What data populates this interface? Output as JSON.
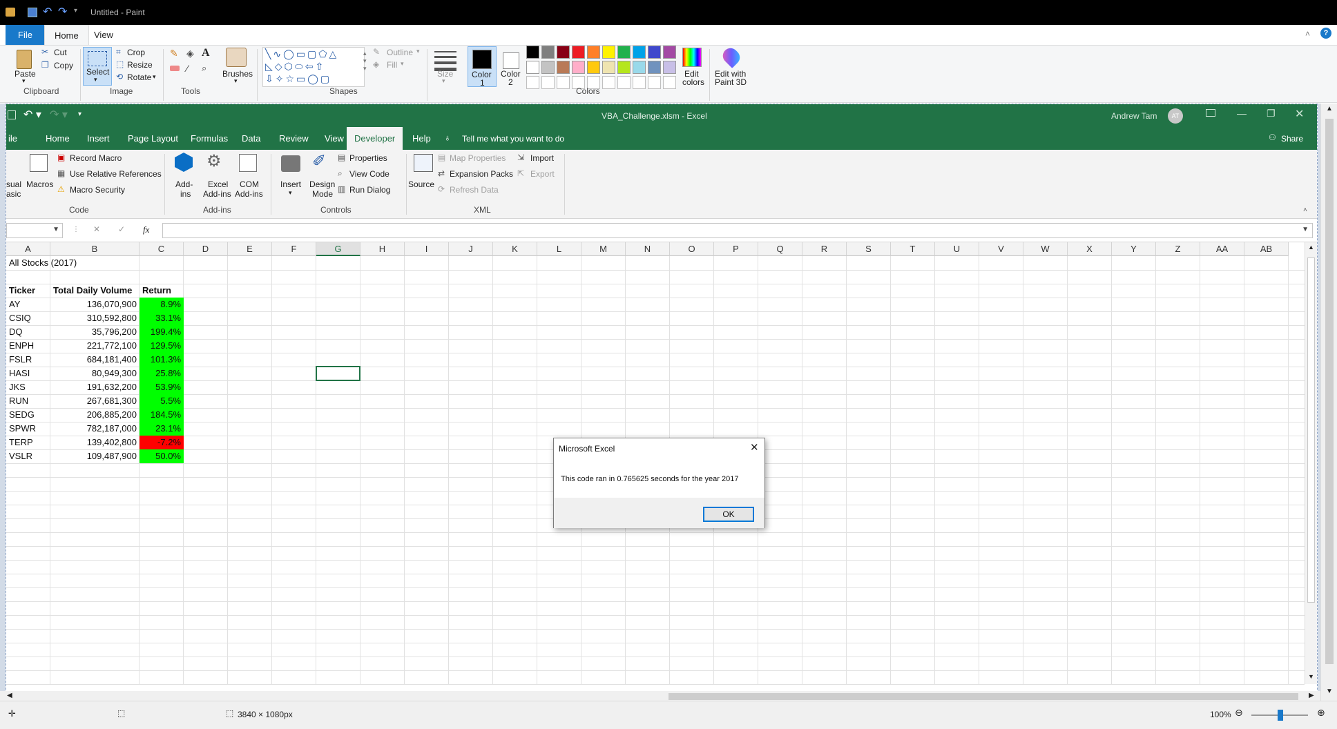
{
  "paint": {
    "title": "Untitled - Paint",
    "tabs": [
      "File",
      "Home",
      "View"
    ],
    "clipboard": {
      "paste": "Paste",
      "cut": "Cut",
      "copy": "Copy",
      "group": "Clipboard"
    },
    "image": {
      "select": "Select",
      "crop": "Crop",
      "resize": "Resize",
      "rotate": "Rotate",
      "group": "Image"
    },
    "tools": {
      "group": "Tools",
      "brushes": "Brushes"
    },
    "shapes": {
      "outline": "Outline",
      "fill": "Fill",
      "group": "Shapes"
    },
    "size": "Size",
    "colors": {
      "color1": "Color",
      "color1_num": "1",
      "color2": "Color",
      "color2_num": "2",
      "edit": "Edit",
      "edit2": "colors",
      "group": "Colors",
      "paint3d": "Edit with",
      "paint3d2": "Paint 3D",
      "palette_row1": [
        "#000000",
        "#7f7f7f",
        "#880015",
        "#ed1c24",
        "#ff7f27",
        "#fff200",
        "#22b14c",
        "#00a2e8",
        "#3f48cc",
        "#a349a4"
      ],
      "palette_row2": [
        "#ffffff",
        "#c3c3c3",
        "#b97a57",
        "#ffaec9",
        "#ffc90e",
        "#efe4b0",
        "#b5e61d",
        "#99d9ea",
        "#7092be",
        "#c8bfe7"
      ]
    },
    "status": {
      "dimensions": "3840 × 1080px",
      "zoom": "100%"
    }
  },
  "excel": {
    "title": "VBA_Challenge.xlsm  -  Excel",
    "user": "Andrew Tam",
    "user_initials": "AT",
    "tabs": [
      "ile",
      "Home",
      "Insert",
      "Page Layout",
      "Formulas",
      "Data",
      "Review",
      "View",
      "Developer",
      "Help"
    ],
    "tell_me": "Tell me what you want to do",
    "share": "Share",
    "ribbon": {
      "visual_basic_1": "sual",
      "visual_basic_2": "asic",
      "macros": "Macros",
      "record_macro": "Record Macro",
      "relative_refs": "Use Relative References",
      "macro_security": "Macro Security",
      "code_group": "Code",
      "addins_1": "Add-",
      "addins_2": "ins",
      "excel_addins_1": "Excel",
      "excel_addins_2": "Add-ins",
      "com_addins_1": "COM",
      "com_addins_2": "Add-ins",
      "addins_group": "Add-ins",
      "insert": "Insert",
      "design_1": "Design",
      "design_2": "Mode",
      "properties": "Properties",
      "view_code": "View Code",
      "run_dialog": "Run Dialog",
      "controls_group": "Controls",
      "source": "Source",
      "map_properties": "Map Properties",
      "expansion_packs": "Expansion Packs",
      "refresh_data": "Refresh Data",
      "import": "Import",
      "export": "Export",
      "xml_group": "XML"
    },
    "formula_fx": "fx",
    "columns": [
      "A",
      "B",
      "C",
      "D",
      "E",
      "F",
      "G",
      "H",
      "I",
      "J",
      "K",
      "L",
      "M",
      "N",
      "O",
      "P",
      "Q",
      "R",
      "S",
      "T",
      "U",
      "V",
      "W",
      "X",
      "Y",
      "Z",
      "AA",
      "AB"
    ],
    "sheet": {
      "title": "All Stocks (2017)",
      "headers": [
        "Ticker",
        "Total Daily Volume",
        "Return"
      ],
      "rows": [
        {
          "ticker": "AY",
          "volume": "136,070,900",
          "ret": "8.9%",
          "color": "#00ff00"
        },
        {
          "ticker": "CSIQ",
          "volume": "310,592,800",
          "ret": "33.1%",
          "color": "#00ff00"
        },
        {
          "ticker": "DQ",
          "volume": "35,796,200",
          "ret": "199.4%",
          "color": "#00ff00"
        },
        {
          "ticker": "ENPH",
          "volume": "221,772,100",
          "ret": "129.5%",
          "color": "#00ff00"
        },
        {
          "ticker": "FSLR",
          "volume": "684,181,400",
          "ret": "101.3%",
          "color": "#00ff00"
        },
        {
          "ticker": "HASI",
          "volume": "80,949,300",
          "ret": "25.8%",
          "color": "#00ff00"
        },
        {
          "ticker": "JKS",
          "volume": "191,632,200",
          "ret": "53.9%",
          "color": "#00ff00"
        },
        {
          "ticker": "RUN",
          "volume": "267,681,300",
          "ret": "5.5%",
          "color": "#00ff00"
        },
        {
          "ticker": "SEDG",
          "volume": "206,885,200",
          "ret": "184.5%",
          "color": "#00ff00"
        },
        {
          "ticker": "SPWR",
          "volume": "782,187,000",
          "ret": "23.1%",
          "color": "#00ff00"
        },
        {
          "ticker": "TERP",
          "volume": "139,402,800",
          "ret": "-7.2%",
          "color": "#ff0000"
        },
        {
          "ticker": "VSLR",
          "volume": "109,487,900",
          "ret": "50.0%",
          "color": "#00ff00"
        }
      ]
    },
    "dialog": {
      "title": "Microsoft Excel",
      "message": "This code ran in 0.765625 seconds for the year 2017",
      "ok": "OK"
    }
  }
}
